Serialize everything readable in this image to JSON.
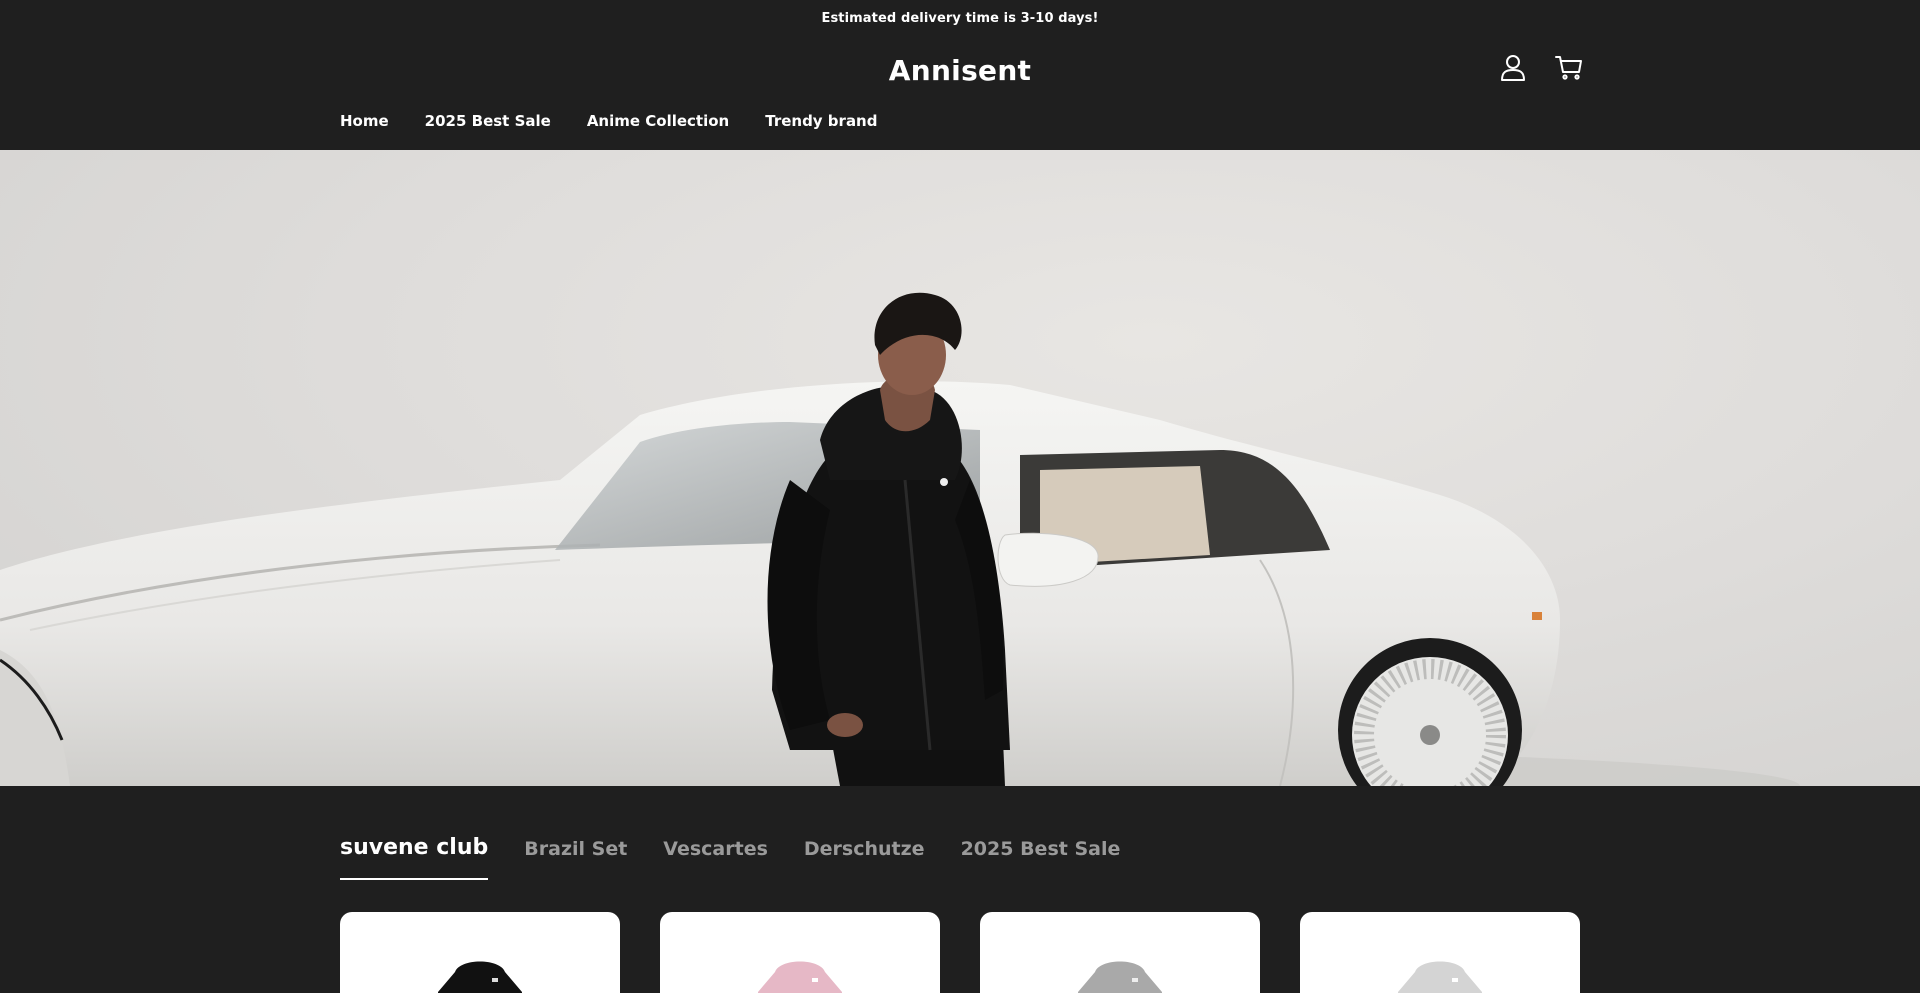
{
  "announcement": "Estimated delivery time is 3-10 days!",
  "brand": "Annisent",
  "header_icons": [
    "account-icon",
    "cart-icon"
  ],
  "nav": [
    {
      "label": "Home"
    },
    {
      "label": "2025 Best Sale"
    },
    {
      "label": "Anime Collection"
    },
    {
      "label": "Trendy brand"
    }
  ],
  "hero": {
    "image": "model in black hoodie leaning on white car"
  },
  "tabs": [
    {
      "label": "suvene club",
      "active": true
    },
    {
      "label": "Brazil Set",
      "active": false
    },
    {
      "label": "Vescartes",
      "active": false
    },
    {
      "label": "Derschutze",
      "active": false
    },
    {
      "label": "2025 Best Sale",
      "active": false
    }
  ],
  "products": [
    {
      "color": "#111111"
    },
    {
      "color": "#e6b8c6"
    },
    {
      "color": "#a9a9a9"
    },
    {
      "color": "#d4d4d4"
    }
  ],
  "colors": {
    "background": "#1f1f1f",
    "text": "#ffffff",
    "tab_inactive": "#9a9a9a",
    "card": "#ffffff"
  }
}
